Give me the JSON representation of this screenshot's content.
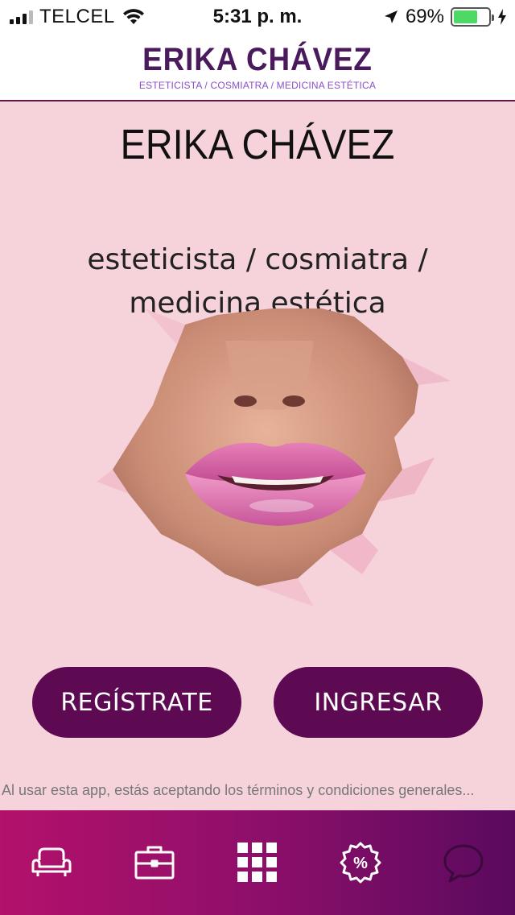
{
  "status_bar": {
    "carrier": "TELCEL",
    "time": "5:31 p. m.",
    "battery_percent": "69%",
    "battery_level": 0.69,
    "icons": [
      "signal-icon",
      "wifi-icon",
      "location-arrow-icon",
      "battery-icon",
      "charging-bolt-icon"
    ]
  },
  "header": {
    "brand": "ERIKA CHÁVEZ",
    "tagline": "ESTETICISTA / COSMIATRA / MEDICINA ESTÉTICA"
  },
  "hero": {
    "title": "ERIKA CHÁVEZ",
    "subtitle_line1": "esteticista / cosmiatra /",
    "subtitle_line2": "medicina estética"
  },
  "actions": {
    "register_label": "REGÍSTRATE",
    "login_label": "INGRESAR"
  },
  "terms_text": "Al usar esta app, estás aceptando los términos y condiciones generales...",
  "tabbar": {
    "items": [
      {
        "icon": "sofa-icon"
      },
      {
        "icon": "briefcase-icon"
      },
      {
        "icon": "grid-icon"
      },
      {
        "icon": "discount-badge-icon"
      },
      {
        "icon": "chat-bubble-icon"
      }
    ]
  },
  "colors": {
    "brand_purple": "#4b1a5c",
    "button_purple": "#5e0a52",
    "background_pink": "#f6d3db",
    "tab_gradient_start": "#b3116b",
    "tab_gradient_end": "#5a0a5e"
  }
}
